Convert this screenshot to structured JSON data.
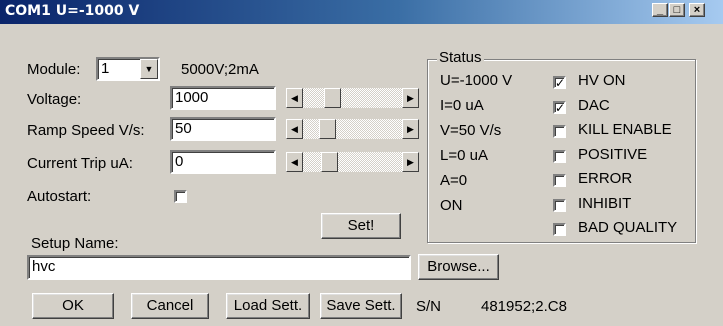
{
  "window": {
    "title": "COM1 U=-1000 V",
    "minimize": "_",
    "maximize": "□",
    "close": "×"
  },
  "module": {
    "label": "Module:",
    "value": "1",
    "spec": "5000V;2mA"
  },
  "voltage": {
    "label": "Voltage:",
    "value": "1000",
    "slider_level": 0.25
  },
  "ramp": {
    "label": "Ramp Speed V/s:",
    "value": "50",
    "slider_level": 0.2
  },
  "trip": {
    "label": "Current Trip uA:",
    "value": "0",
    "slider_level": 0.22
  },
  "autostart": {
    "label": "Autostart:",
    "checked": false
  },
  "set_button": "Set!",
  "setup": {
    "label": "Setup Name:",
    "value": "hvc"
  },
  "browse_button": "Browse...",
  "buttons": {
    "ok": "OK",
    "cancel": "Cancel",
    "load": "Load Sett.",
    "save": "Save Sett."
  },
  "serial": {
    "label": "S/N",
    "value": "481952;2.C8"
  },
  "status": {
    "title": "Status",
    "values": [
      "U=-1000 V",
      "I=0 uA",
      "V=50 V/s",
      "L=0 uA",
      "A=0",
      "ON"
    ],
    "flags": [
      {
        "label": "HV ON",
        "checked": true
      },
      {
        "label": "DAC",
        "checked": true
      },
      {
        "label": "KILL ENABLE",
        "checked": false
      },
      {
        "label": "POSITIVE",
        "checked": false
      },
      {
        "label": "ERROR",
        "checked": false
      },
      {
        "label": "INHIBIT",
        "checked": false
      },
      {
        "label": "BAD QUALITY",
        "checked": false
      }
    ]
  },
  "colors": {
    "face": "#d4d0c8",
    "title_start": "#0a246a",
    "title_end": "#a6caf0"
  }
}
